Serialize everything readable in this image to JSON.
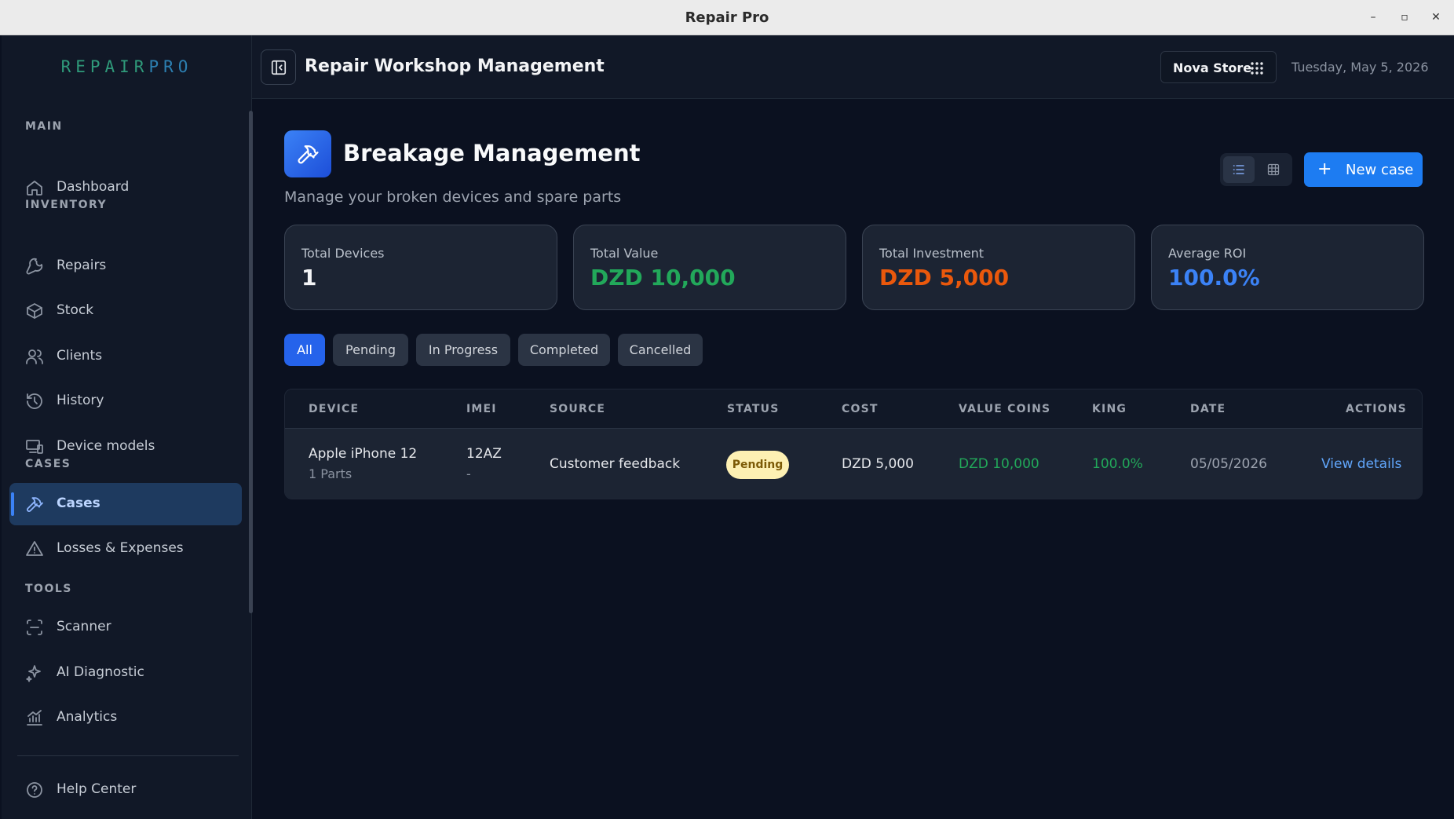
{
  "window": {
    "title": "Repair Pro",
    "minimize": "–",
    "maximize": "▫",
    "close": "✕"
  },
  "sidebar": {
    "logo_part1": "REPAIR",
    "logo_part2": "PRO",
    "sections": {
      "main": "MAIN",
      "inventory": "INVENTORY",
      "cases": "CASES",
      "tools": "TOOLS"
    },
    "items": {
      "dashboard": "Dashboard",
      "repairs": "Repairs",
      "stock": "Stock",
      "clients": "Clients",
      "history": "History",
      "device_models": "Device models",
      "cases": "Cases",
      "losses": "Losses & Expenses",
      "scanner": "Scanner",
      "ai_diagnostic": "AI Diagnostic",
      "analytics": "Analytics",
      "help": "Help Center"
    },
    "active_item": "cases"
  },
  "header": {
    "title": "Repair Workshop Management",
    "store": "Nova Store",
    "date": "Tuesday, May 5, 2026"
  },
  "page": {
    "title": "Breakage Management",
    "subtitle": "Manage your broken devices and spare parts",
    "new_case": "New case",
    "active_view": "list"
  },
  "stats": [
    {
      "label": "Total Devices",
      "value": "1",
      "color": "#f3f4f6"
    },
    {
      "label": "Total Value",
      "value": "DZD 10,000",
      "color": "#22a85a"
    },
    {
      "label": "Total Investment",
      "value": "DZD 5,000",
      "color": "#ea580c"
    },
    {
      "label": "Average ROI",
      "value": "100.0%",
      "color": "#3b82f6"
    }
  ],
  "filters": [
    "All",
    "Pending",
    "In Progress",
    "Completed",
    "Cancelled"
  ],
  "active_filter": "All",
  "table": {
    "columns": [
      "DEVICE",
      "IMEI",
      "SOURCE",
      "STATUS",
      "COST",
      "VALUE COINS",
      "KING",
      "DATE",
      "ACTIONS"
    ],
    "rows": [
      {
        "device": "Apple iPhone 12",
        "parts": "1 Parts",
        "imei": "12AZ",
        "imei_sub": "-",
        "source": "Customer feedback",
        "status": "Pending",
        "cost": "DZD 5,000",
        "value_coins": "DZD 10,000",
        "king": "100.0%",
        "date": "05/05/2026",
        "action": "View details"
      }
    ]
  }
}
